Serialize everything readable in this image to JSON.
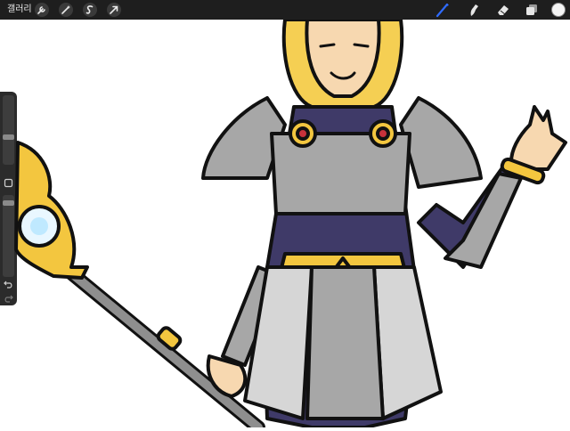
{
  "toolbar": {
    "gallery_label": "갤러리",
    "left_tools": [
      "wrench-icon",
      "magic-wand-icon",
      "selection-icon",
      "transform-arrow-icon"
    ],
    "right_tools": [
      "brush-icon",
      "smudge-icon",
      "eraser-icon",
      "layers-icon",
      "color-swatch"
    ],
    "active_tool_color": "#2f6bff",
    "swatch_color": "#f4f4f4"
  },
  "sidebar": {
    "brush_size_level": 0.35,
    "opacity_level": 0.9
  },
  "artwork": {
    "name": "armored-heroine-with-staff",
    "colors": {
      "armor": "#a7a7a7",
      "gold": "#f3c63f",
      "bodysuit": "#3f3a68",
      "skin": "#f7d8b0",
      "hair": "#f5cf53",
      "gem": "#c8323b",
      "orb": "#bfe9ff"
    }
  }
}
